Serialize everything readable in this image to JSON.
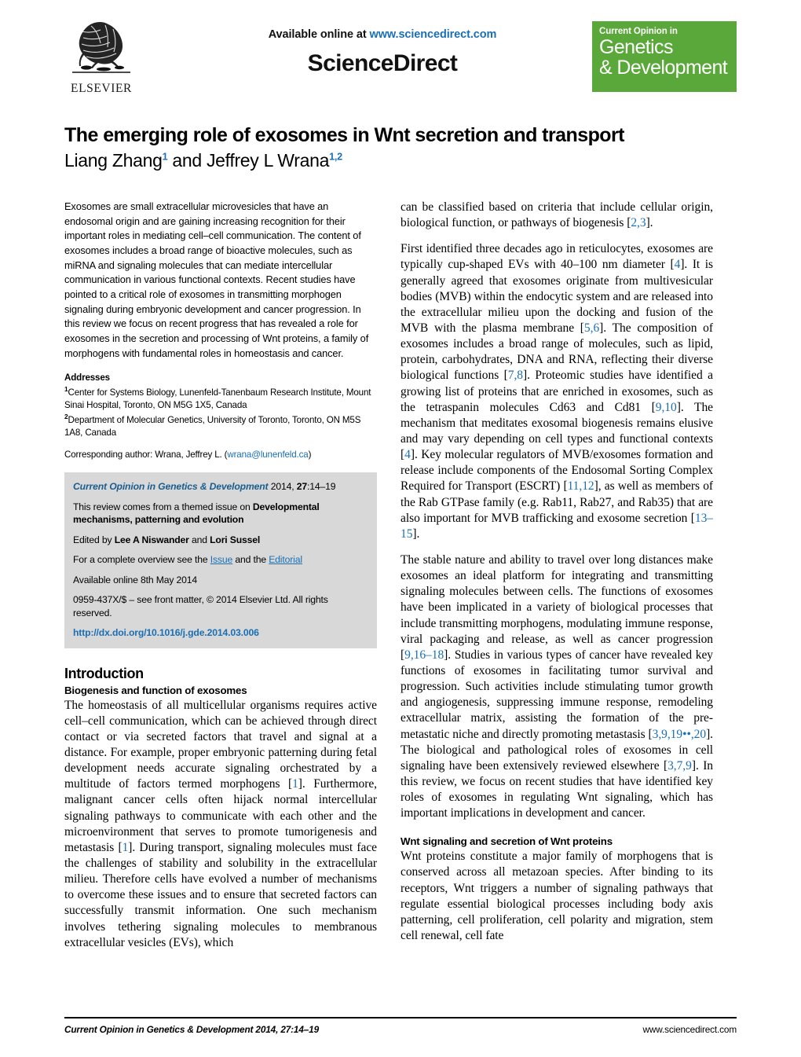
{
  "masthead": {
    "available_prefix": "Available online at ",
    "available_url": "www.sciencedirect.com",
    "sciencedirect_wordmark": "ScienceDirect",
    "elsevier_label": "ELSEVIER",
    "journal_logo_small": "Current Opinion in",
    "journal_logo_line1": "Genetics",
    "journal_logo_line2": "& Development",
    "journal_logo_color": "#5aa83a"
  },
  "article": {
    "title": "The emerging role of exosomes in Wnt secretion and transport",
    "author1_name": "Liang Zhang",
    "author1_sup": "1",
    "author_conjunction": " and ",
    "author2_name": "Jeffrey L Wrana",
    "author2_sup": "1,2"
  },
  "abstract": {
    "text": "Exosomes are small extracellular microvesicles that have an endosomal origin and are gaining increasing recognition for their important roles in mediating cell–cell communication. The content of exosomes includes a broad range of bioactive molecules, such as miRNA and signaling molecules that can mediate intercellular communication in various functional contexts. Recent studies have pointed to a critical role of exosomes in transmitting morphogen signaling during embryonic development and cancer progression. In this review we focus on recent progress that has revealed a role for exosomes in the secretion and processing of Wnt proteins, a family of morphogens with fundamental roles in homeostasis and cancer."
  },
  "addresses": {
    "heading": "Addresses",
    "aff1_sup": "1",
    "aff1": "Center for Systems Biology, Lunenfeld-Tanenbaum Research Institute, Mount Sinai Hospital, Toronto, ON M5G 1X5, Canada",
    "aff2_sup": "2",
    "aff2": "Department of Molecular Genetics, University of Toronto, Toronto, ON M5S 1A8, Canada",
    "corresponding_prefix": "Corresponding author: Wrana, Jeffrey L. (",
    "corresponding_email": "wrana@lunenfeld.ca",
    "corresponding_suffix": ")"
  },
  "infobox": {
    "citation_journal": "Current Opinion in Genetics & Development",
    "citation_rest_pre": " 2014, ",
    "citation_volume": "27",
    "citation_pages": ":14–19",
    "themed_pre": "This review comes from a themed issue on ",
    "themed_bold": "Developmental mechanisms, patterning and evolution",
    "edited_pre": "Edited by ",
    "edited_ed1": "Lee A Niswander",
    "edited_mid": " and ",
    "edited_ed2": "Lori Sussel",
    "overview_pre": "For a complete overview see the ",
    "overview_link1": "Issue",
    "overview_mid": " and the ",
    "overview_link2": "Editorial",
    "available_online": "Available online 8th May 2014",
    "copyright": "0959-437X/$ – see front matter, © 2014 Elsevier Ltd. All rights reserved.",
    "doi": "http://dx.doi.org/10.1016/j.gde.2014.03.006"
  },
  "left_column": {
    "section_heading": "Introduction",
    "subsection_heading": "Biogenesis and function of exosomes",
    "para1_a": "The homeostasis of all multicellular organisms requires active cell–cell communication, which can be achieved through direct contact or via secreted factors that travel and signal at a distance. For example, proper embryonic patterning during fetal development needs accurate signaling orchestrated by a multitude of factors termed morphogens [",
    "para1_cite1": "1",
    "para1_b": "]. Furthermore, malignant cancer cells often hijack normal intercellular signaling pathways to communicate with each other and the microenvironment that serves to promote tumorigenesis and metastasis [",
    "para1_cite2": "1",
    "para1_c": "]. During transport, signaling molecules must face the challenges of stability and solubility in the extracellular milieu. Therefore cells have evolved a number of mechanisms to overcome these issues and to ensure that secreted factors can successfully transmit information. One such mechanism involves tethering signaling molecules to membranous extracellular vesicles (EVs), which"
  },
  "right_column": {
    "para1_a": "can be classified based on criteria that include cellular origin, biological function, or pathways of biogenesis [",
    "para1_cite": "2,3",
    "para1_b": "].",
    "para2_a": "First identified three decades ago in reticulocytes, exosomes are typically cup-shaped EVs with 40–100 nm diameter [",
    "para2_cite1": "4",
    "para2_b": "]. It is generally agreed that exosomes originate from multivesicular bodies (MVB) within the endocytic system and are released into the extracellular milieu upon the docking and fusion of the MVB with the plasma membrane [",
    "para2_cite2": "5,6",
    "para2_c": "]. The composition of exosomes includes a broad range of molecules, such as lipid, protein, carbohydrates, DNA and RNA, reflecting their diverse biological functions [",
    "para2_cite3": "7,8",
    "para2_d": "]. Proteomic studies have identified a growing list of proteins that are enriched in exosomes, such as the tetraspanin molecules Cd63 and Cd81 [",
    "para2_cite4": "9,10",
    "para2_e": "]. The mechanism that meditates exosomal biogenesis remains elusive and may vary depending on cell types and functional contexts [",
    "para2_cite5": "4",
    "para2_f": "]. Key molecular regulators of MVB/exosomes formation and release include components of the Endosomal Sorting Complex Required for Transport (ESCRT) [",
    "para2_cite6": "11,12",
    "para2_g": "], as well as members of the Rab GTPase family (e.g. Rab11, Rab27, and Rab35) that are also important for MVB trafficking and exosome secretion [",
    "para2_cite7": "13–15",
    "para2_h": "].",
    "para3_a": "The stable nature and ability to travel over long distances make exosomes an ideal platform for integrating and transmitting signaling molecules between cells. The functions of exosomes have been implicated in a variety of biological processes that include transmitting morphogens, modulating immune response, viral packaging and release, as well as cancer progression [",
    "para3_cite1": "9,16–18",
    "para3_b": "]. Studies in various types of cancer have revealed key functions of exosomes in facilitating tumor survival and progression. Such activities include stimulating tumor growth and angiogenesis, suppressing immune response, remodeling extracellular matrix, assisting the formation of the pre-metastatic niche and directly promoting metastasis [",
    "para3_cite2": "3,9,19••,20",
    "para3_c": "]. The biological and pathological roles of exosomes in cell signaling have been extensively reviewed elsewhere [",
    "para3_cite3": "3,7,9",
    "para3_d": "]. In this review, we focus on recent studies that have identified key roles of exosomes in regulating Wnt signaling, which has important implications in development and cancer.",
    "subsection_heading": "Wnt signaling and secretion of Wnt proteins",
    "para4": "Wnt proteins constitute a major family of morphogens that is conserved across all metazoan species. After binding to its receptors, Wnt triggers a number of signaling pathways that regulate essential biological processes including body axis patterning, cell proliferation, cell polarity and migration, stem cell renewal, cell fate"
  },
  "footer": {
    "left": "Current Opinion in Genetics & Development 2014, 27:14–19",
    "right": "www.sciencedirect.com"
  }
}
